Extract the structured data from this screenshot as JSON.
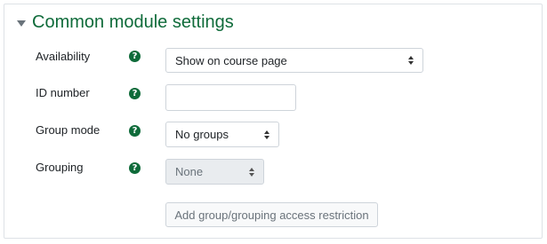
{
  "section": {
    "title": "Common module settings"
  },
  "fields": {
    "availability": {
      "label": "Availability",
      "value": "Show on course page"
    },
    "id_number": {
      "label": "ID number",
      "value": ""
    },
    "group_mode": {
      "label": "Group mode",
      "value": "No groups"
    },
    "grouping": {
      "label": "Grouping",
      "value": "None"
    }
  },
  "help_icon_glyph": "?",
  "restriction_button": {
    "label": "Add group/grouping access restriction"
  },
  "colors": {
    "accent": "#0f6b3a",
    "border": "#ced4da",
    "disabled_bg": "#e9ecef"
  }
}
